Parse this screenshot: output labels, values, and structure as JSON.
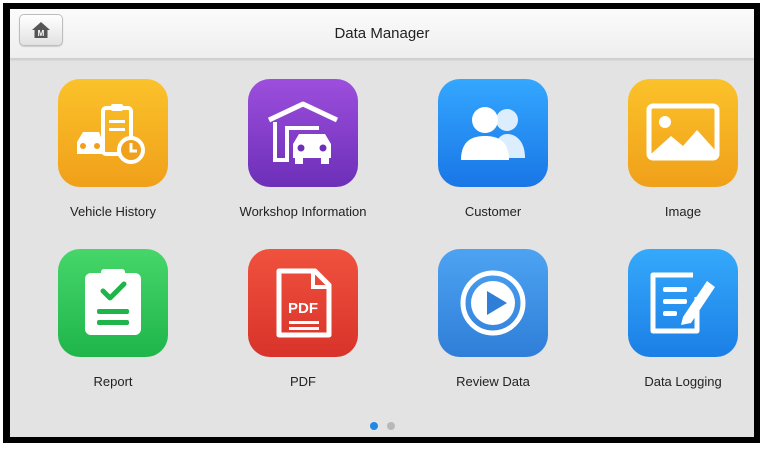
{
  "header": {
    "title": "Data Manager",
    "home_badge": "M"
  },
  "apps": [
    {
      "label": "Vehicle History",
      "icon": "vehicle-history-icon",
      "color_top": "#fbc22a",
      "color_bottom": "#f0a01a"
    },
    {
      "label": "Workshop Information",
      "icon": "workshop-garage-icon",
      "color_top": "#9c4fdc",
      "color_bottom": "#6d2fb8"
    },
    {
      "label": "Customer",
      "icon": "customer-people-icon",
      "color_top": "#34a7ff",
      "color_bottom": "#1976e6"
    },
    {
      "label": "Image",
      "icon": "image-picture-icon",
      "color_top": "#fbc22a",
      "color_bottom": "#f0a01a"
    },
    {
      "label": "Report",
      "icon": "report-clipboard-icon",
      "color_top": "#46d66a",
      "color_bottom": "#1fb54a"
    },
    {
      "label": "PDF",
      "icon": "pdf-document-icon",
      "color_top": "#f0523e",
      "color_bottom": "#d8332a"
    },
    {
      "label": "Review Data",
      "icon": "review-play-icon",
      "color_top": "#4da3f2",
      "color_bottom": "#2f7ed8"
    },
    {
      "label": "Data Logging",
      "icon": "data-logging-edit-icon",
      "color_top": "#35a9fb",
      "color_bottom": "#1b7fe6"
    }
  ],
  "pagination": {
    "pages": 2,
    "current_page": 1,
    "active_color": "#1e88e5",
    "inactive_color": "#b8b8b8"
  }
}
